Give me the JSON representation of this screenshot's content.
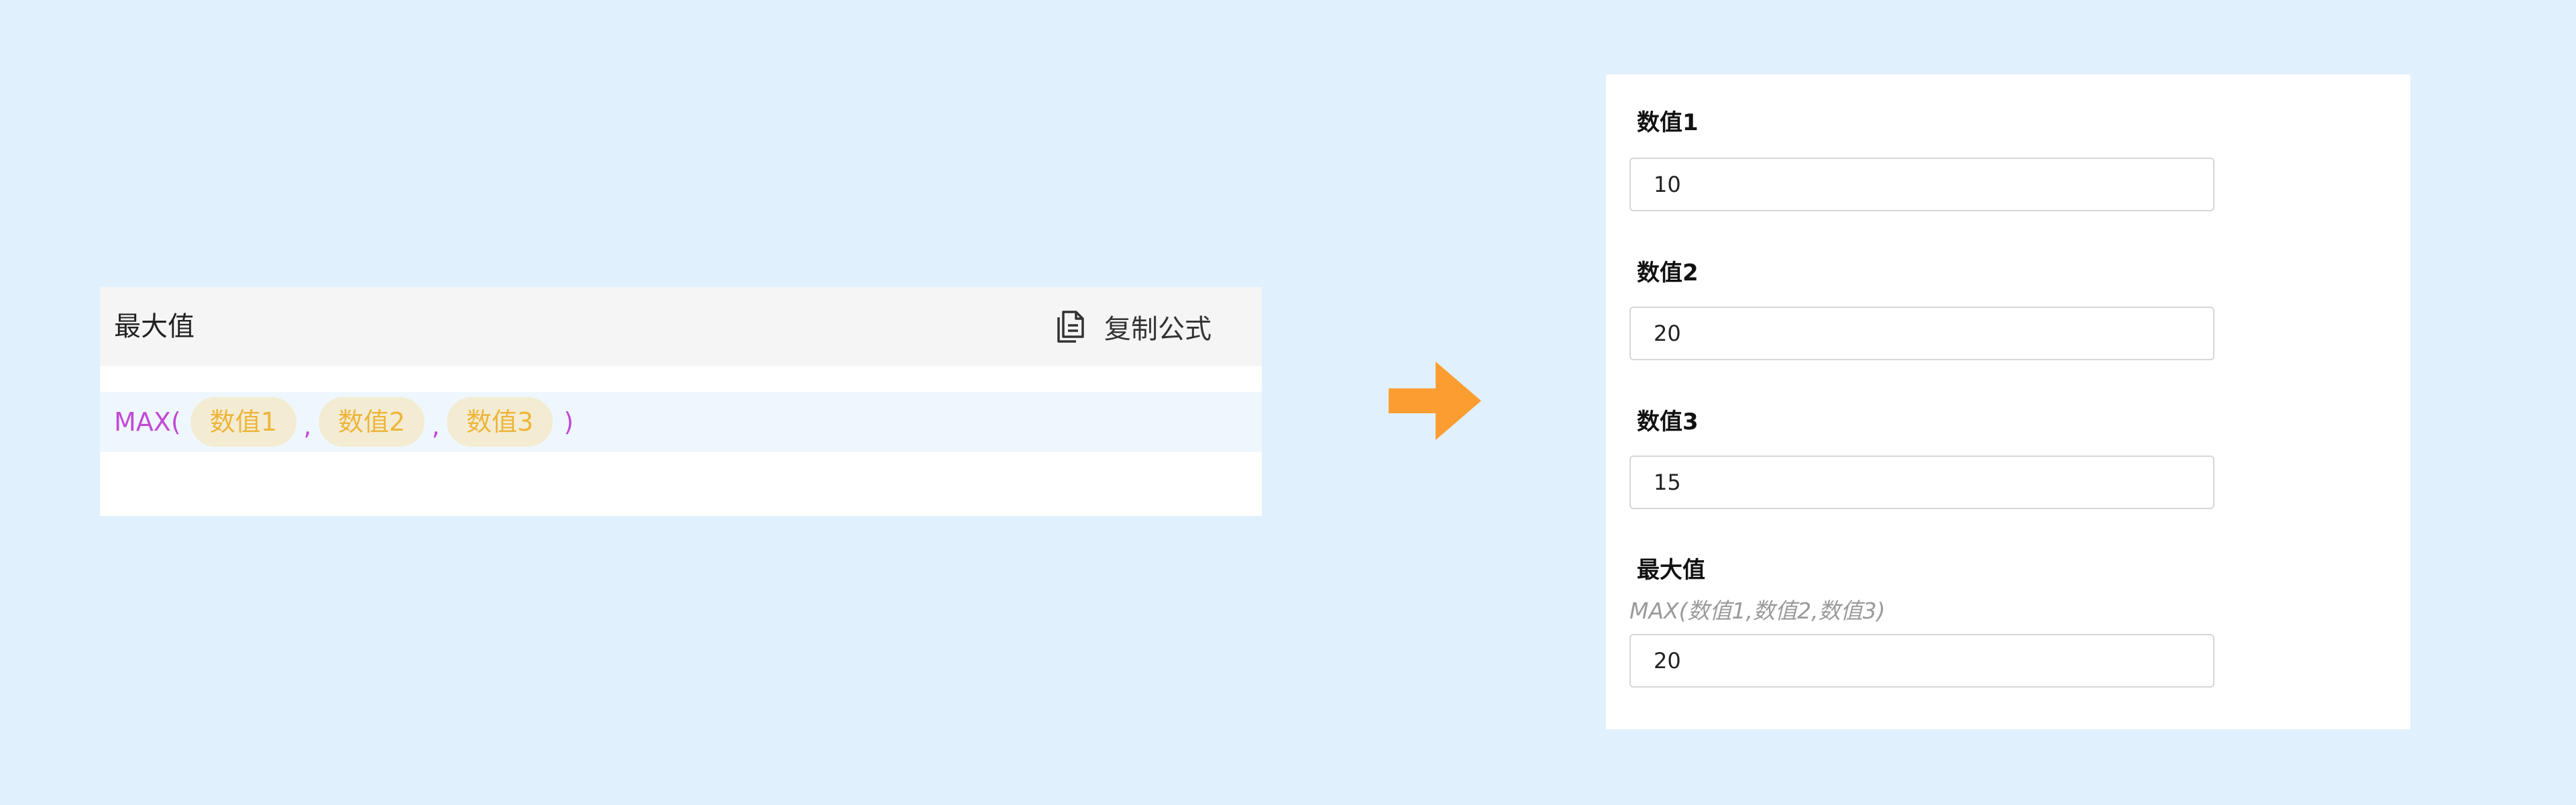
{
  "formula_card": {
    "title": "最大值",
    "copy_label": "复制公式",
    "function_open": "MAX(",
    "args": [
      "数值1",
      "数值2",
      "数值3"
    ],
    "separator": ",",
    "function_close": ")"
  },
  "form": {
    "fields": [
      {
        "label": "数值1",
        "value": "10"
      },
      {
        "label": "数值2",
        "value": "20"
      },
      {
        "label": "数值3",
        "value": "15"
      }
    ],
    "result": {
      "label": "最大值",
      "formula_hint": "MAX(数值1,数值2,数值3)",
      "value": "20"
    }
  },
  "colors": {
    "background": "#e1f0fd",
    "function_text": "#c24ad6",
    "chip_text": "#eeb53a",
    "chip_background": "#f3ecd3",
    "arrow": "#fc9d31"
  },
  "icons": {
    "copy": "copy-document-icon",
    "arrow": "arrow-right-icon"
  }
}
